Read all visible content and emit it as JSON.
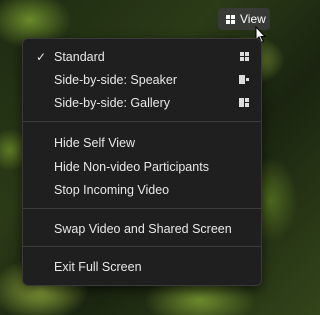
{
  "toolbar": {
    "view_label": "View"
  },
  "menu": {
    "items": [
      {
        "label": "Standard",
        "checked": true,
        "icon": "grid-icon"
      },
      {
        "label": "Side-by-side: Speaker",
        "icon": "speaker-layout-icon"
      },
      {
        "label": "Side-by-side: Gallery",
        "icon": "gallery-layout-icon"
      },
      {
        "label": "Hide Self View"
      },
      {
        "label": "Hide Non-video Participants"
      },
      {
        "label": "Stop Incoming Video"
      },
      {
        "label": "Swap Video and Shared Screen"
      },
      {
        "label": "Exit Full Screen"
      }
    ],
    "check_glyph": "✓"
  }
}
